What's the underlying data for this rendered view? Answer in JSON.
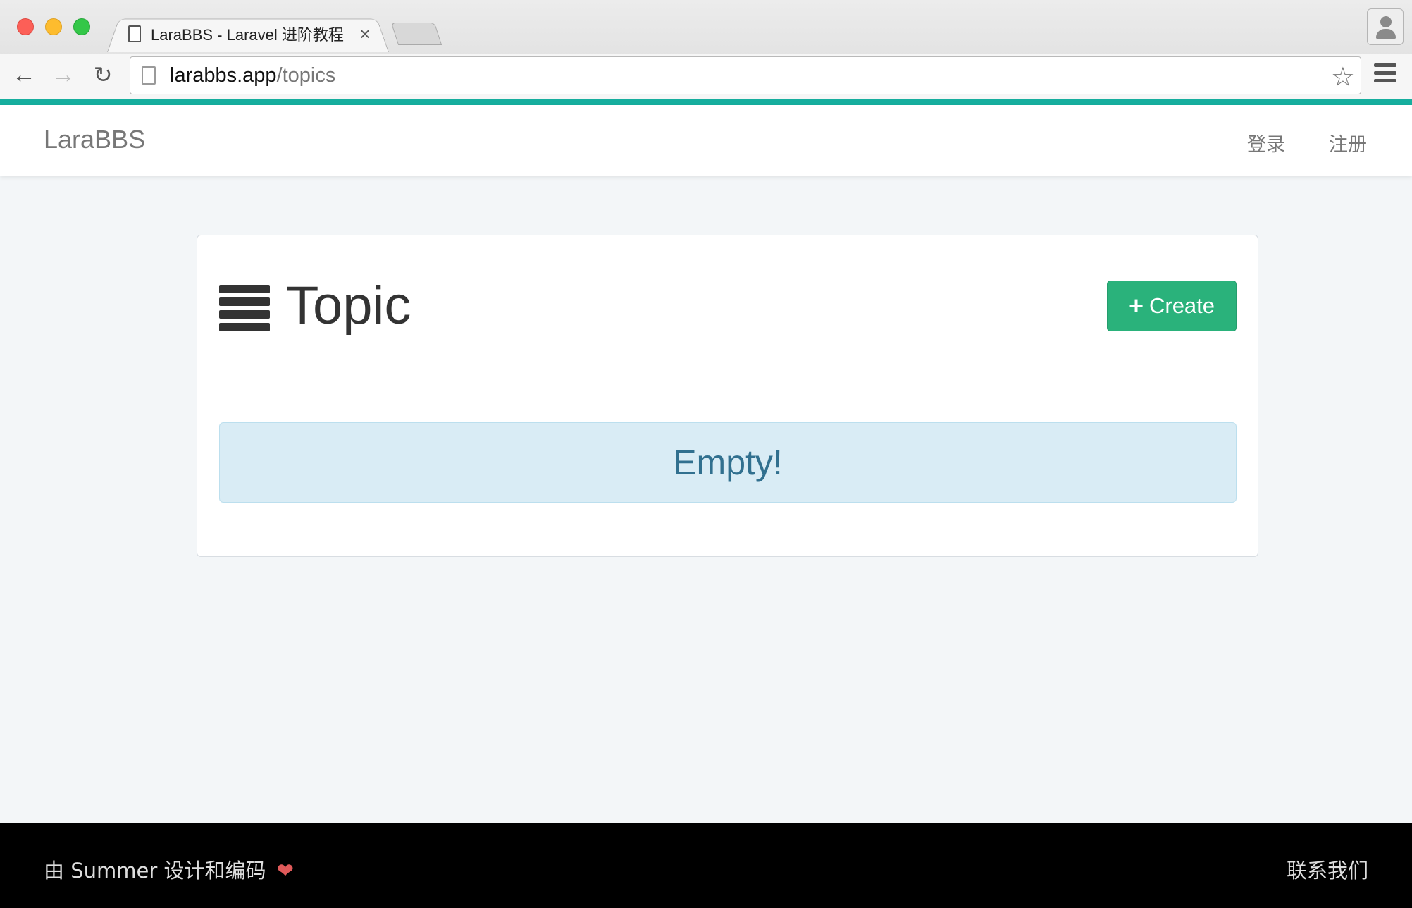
{
  "browser": {
    "tab_title": "LaraBBS - Laravel 进阶教程",
    "tab_close": "×",
    "url_host": "larabbs.app",
    "url_path": "/topics",
    "icons": {
      "back": "arrow-left-icon",
      "forward": "arrow-right-icon",
      "reload": "reload-icon",
      "bookmark": "star-icon",
      "menu": "hamburger-menu-icon",
      "profile": "user-profile-icon"
    }
  },
  "navbar": {
    "brand": "LaraBBS",
    "login": "登录",
    "register": "注册",
    "accent_color": "#16ae9e"
  },
  "panel": {
    "title": "Topic",
    "title_icon": "list-icon",
    "create_label": "Create",
    "create_icon": "plus-icon",
    "create_color": "#2ab27b",
    "empty_message": "Empty!"
  },
  "footer": {
    "credit": "由 Summer 设计和编码",
    "heart": "❤",
    "contact": "联系我们"
  }
}
